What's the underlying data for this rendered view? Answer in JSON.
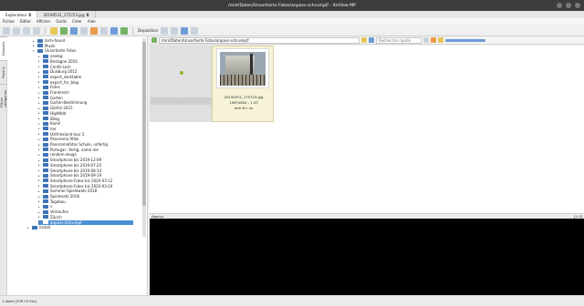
{
  "window": {
    "title": "/mnt/Daten/Unsortierte Fotos/anpass-schrumpf/ - XnView MP"
  },
  "tabs": [
    {
      "label": "Explorateur",
      "close": "X"
    },
    {
      "label": "20190531_175723.jpg",
      "close": "X"
    }
  ],
  "menu": [
    "Fichier",
    "Éditer",
    "Afficher",
    "Outils",
    "Créer",
    "Aide"
  ],
  "toolbar": {
    "disposition_label": "Disposition",
    "colors": {
      "blue": "#6f9bd6",
      "green": "#75b366",
      "yellow": "#e7c75b",
      "orange": "#e89b4b"
    }
  },
  "sidetabs": [
    "Dossiers",
    "Favoris",
    "Filtres catégories"
  ],
  "tree": {
    "items": [
      {
        "label": "lost+found",
        "expanded": false
      },
      {
        "label": "Musik",
        "expanded": false
      },
      {
        "label": "Unsortierte Fotos",
        "expanded": true
      },
      {
        "label": "analog",
        "expanded": false
      },
      {
        "label": "Bretagne 2016",
        "expanded": false
      },
      {
        "label": "Contti-Loch",
        "expanded": false
      },
      {
        "label": "Duisburg 2015",
        "expanded": false
      },
      {
        "label": "export_darktable",
        "expanded": false
      },
      {
        "label": "export_for_blog",
        "expanded": false
      },
      {
        "label": "Fotos",
        "expanded": false
      },
      {
        "label": "Frankreich",
        "expanded": false
      },
      {
        "label": "Garten",
        "expanded": false
      },
      {
        "label": "Garten-Bestimmung",
        "expanded": false
      },
      {
        "label": "Görlitz 2015",
        "expanded": false
      },
      {
        "label": "HighNdd",
        "expanded": false
      },
      {
        "label": "iBlog",
        "expanded": false
      },
      {
        "label": "Kamil",
        "expanded": false
      },
      {
        "label": "me",
        "expanded": false
      },
      {
        "label": "Ostfriesland tour 2",
        "expanded": false
      },
      {
        "label": "Panorama Atlas",
        "expanded": false
      },
      {
        "label": "Panoramafotos Schule, unfertig",
        "expanded": false
      },
      {
        "label": "Portugal - fertig, name me",
        "expanded": false
      },
      {
        "label": "random-zeugs",
        "expanded": false
      },
      {
        "label": "Smartphone bis 2019-12-09",
        "expanded": false
      },
      {
        "label": "Smartphone bis 2019-07-25",
        "expanded": false
      },
      {
        "label": "Smartphone bis 2019-08-14",
        "expanded": false
      },
      {
        "label": "Smartphone bis 2019-09-19",
        "expanded": false
      },
      {
        "label": "Smartphone-Fotos bis 2020-03-12",
        "expanded": false
      },
      {
        "label": "Smartphone-Fotos bis 2020-03-24",
        "expanded": false
      },
      {
        "label": "Sommer-Spielewahl 2018",
        "expanded": false
      },
      {
        "label": "Spielesatz 2018",
        "expanded": false
      },
      {
        "label": "Tagebau",
        "expanded": false
      },
      {
        "label": "v",
        "expanded": false
      },
      {
        "label": "Verkaufen",
        "expanded": false
      },
      {
        "label": "Zürich",
        "expanded": false
      },
      {
        "label": "anpass-schrumpf",
        "expanded": false,
        "selected": true
      },
      {
        "label": "install",
        "expanded": false
      }
    ]
  },
  "address": {
    "path": "/mnt/Daten/Unsortierte Fotos/anpass-schrumpf/",
    "search_placeholder": "Recherche rapide"
  },
  "thumbnails": [
    {
      "label": "..",
      "details": []
    },
    {
      "label": "20190531_175723.jpg",
      "details": [
        "1067x800 - 1.33",
        "mm ft c nv"
      ]
    }
  ],
  "preview": {
    "label": "Aperçu",
    "size": "[1:3]"
  },
  "status": {
    "text": "1 objet [209.23 Kio]"
  }
}
